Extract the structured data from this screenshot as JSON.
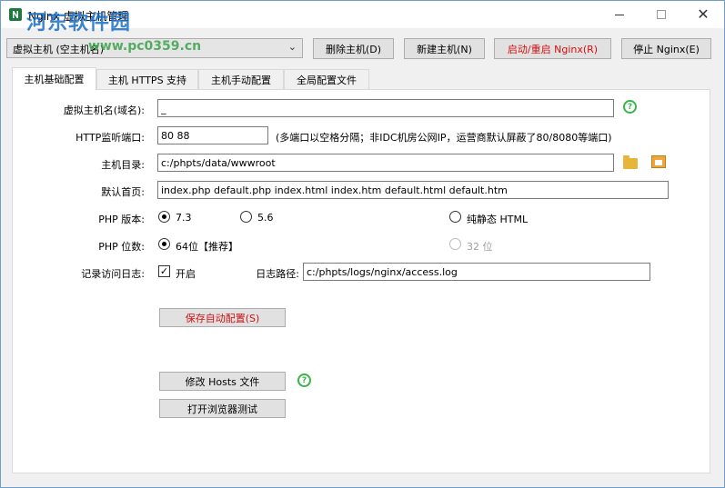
{
  "window": {
    "title": "Nginx 虚拟主机管理",
    "watermark": "河东软件园",
    "watermark_url": "www.pc0359.cn",
    "controls": {
      "minimize": "",
      "maximize": "",
      "close": "✕"
    }
  },
  "toolbar": {
    "host_select_value": "虚拟主机 (空主机名)",
    "delete_label": "删除主机(D)",
    "new_label": "新建主机(N)",
    "restart_label": "启动/重启 Nginx(R)",
    "stop_label": "停止 Nginx(E)"
  },
  "tabs": [
    {
      "label": "主机基础配置",
      "active": true
    },
    {
      "label": "主机 HTTPS 支持",
      "active": false
    },
    {
      "label": "主机手动配置",
      "active": false
    },
    {
      "label": "全局配置文件",
      "active": false
    }
  ],
  "form": {
    "hostname_label": "虚拟主机名(域名):",
    "hostname_value": "_",
    "http_port_label": "HTTP监听端口:",
    "http_port_value": "80 88",
    "http_port_hint": "(多端口以空格分隔；非IDC机房公网IP，运营商默认屏蔽了80/8080等端口)",
    "root_label": "主机目录:",
    "root_value": "c:/phpts/data/wwwroot",
    "index_label": "默认首页:",
    "index_value": "index.php default.php index.html index.htm default.html default.htm",
    "php_version_label": "PHP 版本:",
    "php_versions": [
      {
        "label": "7.3",
        "checked": true
      },
      {
        "label": "5.6",
        "checked": false
      },
      {
        "label": "纯静态 HTML",
        "checked": false
      }
    ],
    "php_bits_label": "PHP 位数:",
    "php_bits": [
      {
        "label": "64位【推荐】",
        "checked": true,
        "disabled": false
      },
      {
        "label": "32 位",
        "checked": false,
        "disabled": true
      }
    ],
    "log_label": "记录访问日志:",
    "log_check_label": "开启",
    "log_checked": true,
    "log_path_label": "日志路径:",
    "log_path_value": "c:/phpts/logs/nginx/access.log",
    "help_glyph": "?"
  },
  "actions": {
    "save_label": "保存自动配置(S)",
    "hosts_label": "修改 Hosts 文件",
    "browser_label": "打开浏览器测试"
  },
  "colors": {
    "accent_red": "#d01010",
    "help_green": "#3bb54a",
    "folder_yellow": "#e8b53a"
  }
}
